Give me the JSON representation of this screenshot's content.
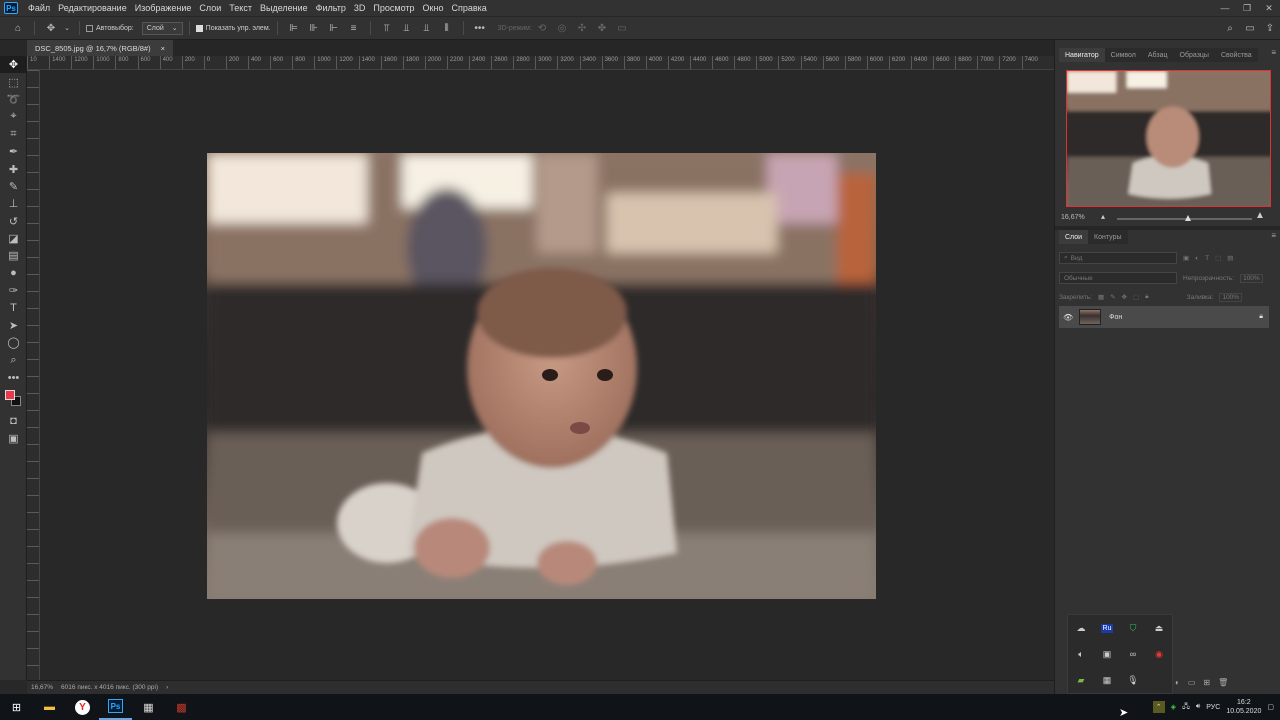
{
  "menubar": {
    "logo": "Ps",
    "items": [
      "Файл",
      "Редактирование",
      "Изображение",
      "Слои",
      "Текст",
      "Выделение",
      "Фильтр",
      "3D",
      "Просмотр",
      "Окно",
      "Справка"
    ]
  },
  "options": {
    "autoselect_label": "Автовыбор:",
    "autoselect_target": "Слой",
    "show_controls_label": "Показать упр. элем.",
    "mode_3d": "3D-режим:"
  },
  "document": {
    "tab_title": "DSC_8505.jpg @ 16,7% (RGB/8#)",
    "close": "×"
  },
  "ruler": {
    "h_labels": [
      "10",
      "1400",
      "1200",
      "1000",
      "800",
      "600",
      "400",
      "200",
      "0",
      "200",
      "400",
      "600",
      "800",
      "1000",
      "1200",
      "1400",
      "1600",
      "1800",
      "2000",
      "2200",
      "2400",
      "2600",
      "2800",
      "3000",
      "3200",
      "3400",
      "3600",
      "3800",
      "4000",
      "4200",
      "4400",
      "4600",
      "4800",
      "5000",
      "5200",
      "5400",
      "5600",
      "5800",
      "6000",
      "6200",
      "6400",
      "6600",
      "6800",
      "7000",
      "7200",
      "7400"
    ]
  },
  "status": {
    "zoom": "16,67%",
    "doc_size": "6016 пикс. x 4016 пикс. (300 ppi)",
    "arrow": "›"
  },
  "panels": {
    "top_tabs": [
      "Навигатор",
      "Символ",
      "Абзац",
      "Образцы",
      "Свойства"
    ],
    "nav_zoom": "16,67%",
    "layer_tabs": [
      "Слои",
      "Контуры"
    ],
    "search_placeholder": "Вид",
    "blend_mode": "Обычные",
    "opacity_label": "Непрозрачность:",
    "opacity_value": "100%",
    "lock_label": "Закрепить:",
    "fill_label": "Заливка:",
    "fill_value": "100%",
    "layer_name": "Фон"
  },
  "taskbar": {
    "lang": "РУС",
    "time": "16:2",
    "date": "10.05.2020"
  },
  "colors": {
    "foreground": "#e8394d",
    "background": "#111111",
    "nav_frame": "#e03030"
  }
}
